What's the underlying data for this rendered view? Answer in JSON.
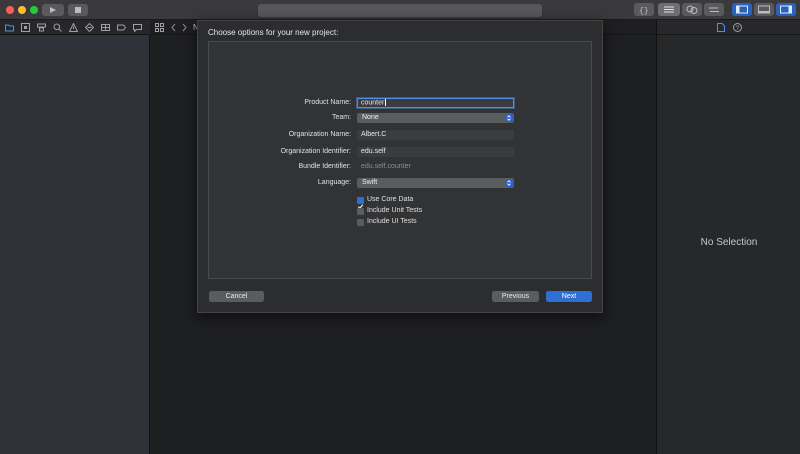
{
  "sheet": {
    "title": "Choose options for your new project:",
    "fields": {
      "product_name": {
        "label": "Product Name:",
        "value": "counter"
      },
      "team": {
        "label": "Team:",
        "value": "None"
      },
      "organization_name": {
        "label": "Organization Name:",
        "value": "Albert.C"
      },
      "organization_identifier": {
        "label": "Organization Identifier:",
        "value": "edu.self"
      },
      "bundle_identifier": {
        "label": "Bundle Identifier:",
        "value": "edu.self.counter"
      },
      "language": {
        "label": "Language:",
        "value": "Swift"
      }
    },
    "options": [
      {
        "label": "Use Core Data",
        "checked": true
      },
      {
        "label": "Include Unit Tests",
        "checked": false
      },
      {
        "label": "Include UI Tests",
        "checked": false
      }
    ],
    "buttons": {
      "cancel": "Cancel",
      "previous": "Previous",
      "next": "Next"
    }
  },
  "inspector": {
    "empty_text": "No Selection"
  },
  "jumpbar": {
    "crumb": "N"
  },
  "colors": {
    "accent": "#2e6fd6",
    "close": "#fe5f57",
    "minimize": "#febc2e",
    "zoom": "#28c840"
  }
}
